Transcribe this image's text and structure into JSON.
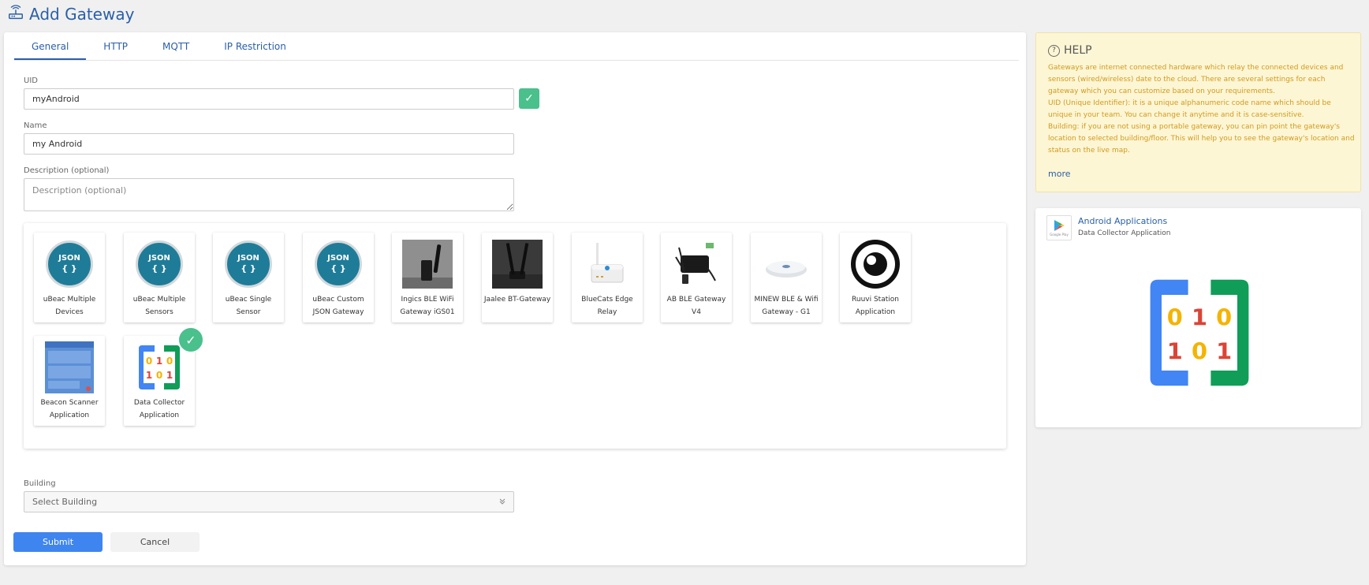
{
  "page": {
    "title": "Add Gateway"
  },
  "tabs": [
    {
      "label": "General",
      "active": true
    },
    {
      "label": "HTTP",
      "active": false
    },
    {
      "label": "MQTT",
      "active": false
    },
    {
      "label": "IP Restriction",
      "active": false
    }
  ],
  "form": {
    "uid": {
      "label": "UID",
      "value": "myAndroid",
      "check_glyph": "✓"
    },
    "name": {
      "label": "Name",
      "value": "my Android"
    },
    "description": {
      "label": "Description (optional)",
      "placeholder": "Description (optional)",
      "value": ""
    },
    "building": {
      "label": "Building",
      "placeholder": "Select Building"
    }
  },
  "gateway_types": [
    {
      "label": "uBeac Multiple Devices",
      "icon": "json-icon",
      "selected": false
    },
    {
      "label": "uBeac Multiple Sensors",
      "icon": "json-icon",
      "selected": false
    },
    {
      "label": "uBeac Single Sensor",
      "icon": "json-icon",
      "selected": false
    },
    {
      "label": "uBeac Custom JSON Gateway",
      "icon": "json-icon",
      "selected": false
    },
    {
      "label": "Ingics BLE WiFi Gateway iGS01",
      "icon": "ingics-gateway-photo",
      "selected": false
    },
    {
      "label": "Jaalee BT-Gateway",
      "icon": "jaalee-gateway-photo",
      "selected": false
    },
    {
      "label": "BlueCats Edge Relay",
      "icon": "bluecats-relay-photo",
      "selected": false
    },
    {
      "label": "AB BLE Gateway V4",
      "icon": "ab-gateway-photo",
      "selected": false
    },
    {
      "label": "MINEW BLE & Wifi Gateway - G1",
      "icon": "minew-gateway-photo",
      "selected": false
    },
    {
      "label": "Ruuvi Station Application",
      "icon": "ruuvi-logo",
      "selected": false
    },
    {
      "label": "Beacon Scanner Application",
      "icon": "beacon-scanner-screenshot",
      "selected": false
    },
    {
      "label": "Data Collector Application",
      "icon": "data-collector-logo",
      "selected": true
    }
  ],
  "json_badge": {
    "line1": "JSON",
    "line2": "{ }"
  },
  "data_collector_digits": [
    "0",
    "1",
    "0",
    "1",
    "0",
    "1"
  ],
  "actions": {
    "submit": "Submit",
    "cancel": "Cancel"
  },
  "help": {
    "title": "HELP",
    "paragraphs": [
      "Gateways are internet connected hardware which relay the connected devices and sensors (wired/wireless) date to the cloud. There are several settings for each gateway which you can customize based on your requirements.",
      "UID (Unique Identifier): it is a unique alphanumeric code name which should be unique in your team. You can change it anytime and it is case-sensitive.",
      "Building: if you are not using a portable gateway, you can pin point the gateway's location to selected building/floor. This will help you to see the gateway's location and status on the live map."
    ],
    "more": "more"
  },
  "app_panel": {
    "title": "Android Applications",
    "subtitle": "Data Collector Application",
    "store_icon": "google-play-icon",
    "store_text": "Google Play"
  },
  "colors": {
    "accent": "#2a5fa8",
    "success": "#4ac08c",
    "submit": "#3f85f0",
    "help_bg": "#fdf6d5",
    "help_text": "#d19a1c",
    "logo_blue": "#4285f4",
    "logo_green": "#0f9d58",
    "logo_yellow": "#f4b400",
    "logo_red": "#db4437"
  }
}
